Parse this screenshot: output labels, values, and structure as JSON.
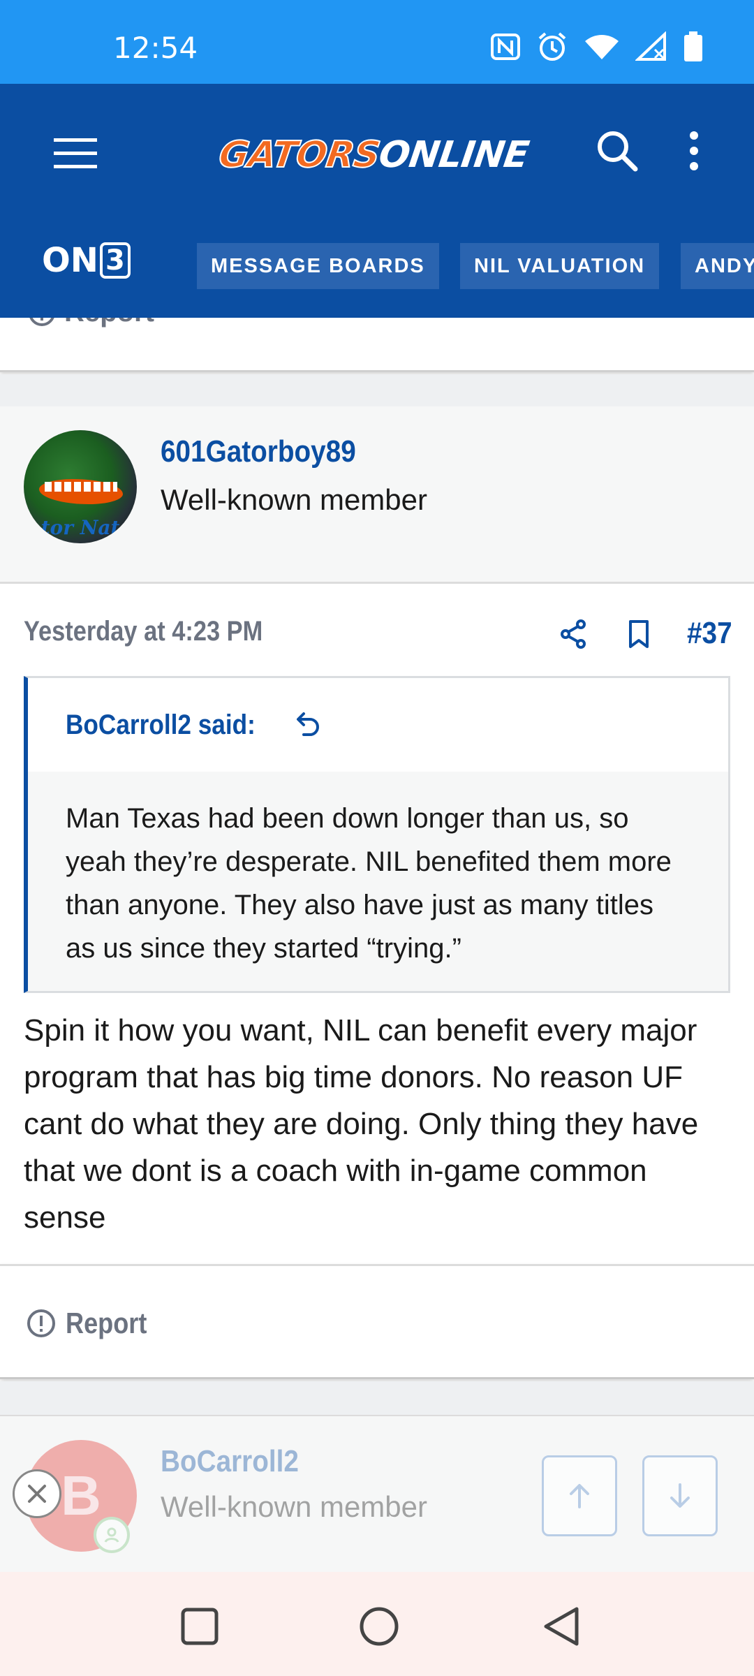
{
  "status_bar": {
    "time": "12:54",
    "icons": [
      "nfc-icon",
      "alarm-icon",
      "wifi-icon",
      "signal-icon",
      "battery-icon"
    ]
  },
  "header": {
    "logo_part1": "GATORS",
    "logo_part2": "ONLINE",
    "brand": "ON3",
    "brand_on": "ON",
    "brand_3": "3",
    "nav_pills": [
      "MESSAGE BOARDS",
      "NIL VALUATION",
      "ANDY"
    ]
  },
  "prev_post": {
    "report_label": "Report"
  },
  "post": {
    "username": "601Gatorboy89",
    "user_title": "Well-known member",
    "avatar_text": "tor Nat",
    "time": "Yesterday at 4:23 PM",
    "number": "#37",
    "quote": {
      "author": "BoCarroll2 said:",
      "text": "Man Texas had been down longer than us, so yeah they’re desperate. NIL benefited them more than anyone. They also have just as many titles as us since they started “trying.”"
    },
    "body": "Spin it how you want, NIL can benefit every major program that has big time donors. No reason UF cant do what they are doing. Only thing they have that we dont is a coach with in-game common sense",
    "report_label": "Report"
  },
  "next_post": {
    "username": "BoCarroll2",
    "user_title": "Well-known member",
    "avatar_letter": "B"
  },
  "colors": {
    "status_bar": "#2196f3",
    "header": "#0b4ea2",
    "logo_orange": "#f26a21",
    "link_blue": "#0b4ea2",
    "muted": "#6b7280"
  }
}
